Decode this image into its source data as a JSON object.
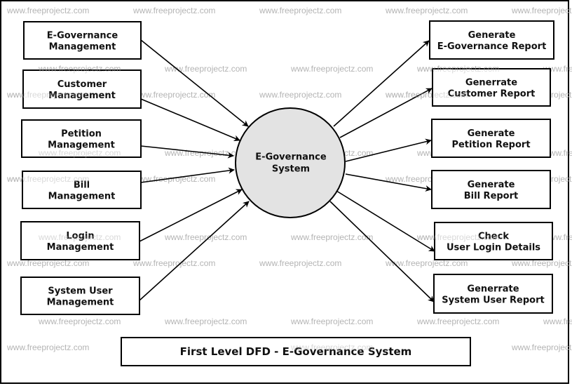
{
  "diagram": {
    "type": "first-level-dfd",
    "title": "First Level DFD - E-Governance System",
    "watermark": "www.freeprojectz.com",
    "colors": {
      "process_fill": "#e3e3e3",
      "stroke": "#000000",
      "text": "#111111",
      "watermark": "#b4b4b4"
    },
    "process": {
      "id": "egov-system",
      "lines": [
        "E-Governance",
        "System"
      ]
    },
    "inputs": [
      {
        "id": "egov-mgmt",
        "lines": [
          "E-Governance",
          "Management"
        ]
      },
      {
        "id": "customer-mgmt",
        "lines": [
          "Customer",
          "Management"
        ]
      },
      {
        "id": "petition-mgmt",
        "lines": [
          "Petition",
          "Management"
        ]
      },
      {
        "id": "bill-mgmt",
        "lines": [
          "Bill",
          "Management"
        ]
      },
      {
        "id": "login-mgmt",
        "lines": [
          "Login",
          "Management"
        ]
      },
      {
        "id": "system-user-mgmt",
        "lines": [
          "System User",
          "Management"
        ]
      }
    ],
    "outputs": [
      {
        "id": "egov-report",
        "lines": [
          "Generate",
          "E-Governance Report"
        ]
      },
      {
        "id": "customer-report",
        "lines": [
          "Generrate",
          "Customer Report"
        ]
      },
      {
        "id": "petition-report",
        "lines": [
          "Generate",
          "Petition Report"
        ]
      },
      {
        "id": "bill-report",
        "lines": [
          "Generate",
          "Bill Report"
        ]
      },
      {
        "id": "user-login-details",
        "lines": [
          "Check",
          "User Login Details"
        ]
      },
      {
        "id": "system-user-report",
        "lines": [
          "Generrate",
          "System User Report"
        ]
      }
    ],
    "flows": [
      {
        "from": "egov-mgmt",
        "to": "egov-system"
      },
      {
        "from": "customer-mgmt",
        "to": "egov-system"
      },
      {
        "from": "petition-mgmt",
        "to": "egov-system"
      },
      {
        "from": "bill-mgmt",
        "to": "egov-system"
      },
      {
        "from": "login-mgmt",
        "to": "egov-system"
      },
      {
        "from": "system-user-mgmt",
        "to": "egov-system"
      },
      {
        "from": "egov-system",
        "to": "egov-report"
      },
      {
        "from": "egov-system",
        "to": "customer-report"
      },
      {
        "from": "egov-system",
        "to": "petition-report"
      },
      {
        "from": "egov-system",
        "to": "bill-report"
      },
      {
        "from": "egov-system",
        "to": "user-login-details"
      },
      {
        "from": "egov-system",
        "to": "system-user-report"
      }
    ]
  }
}
